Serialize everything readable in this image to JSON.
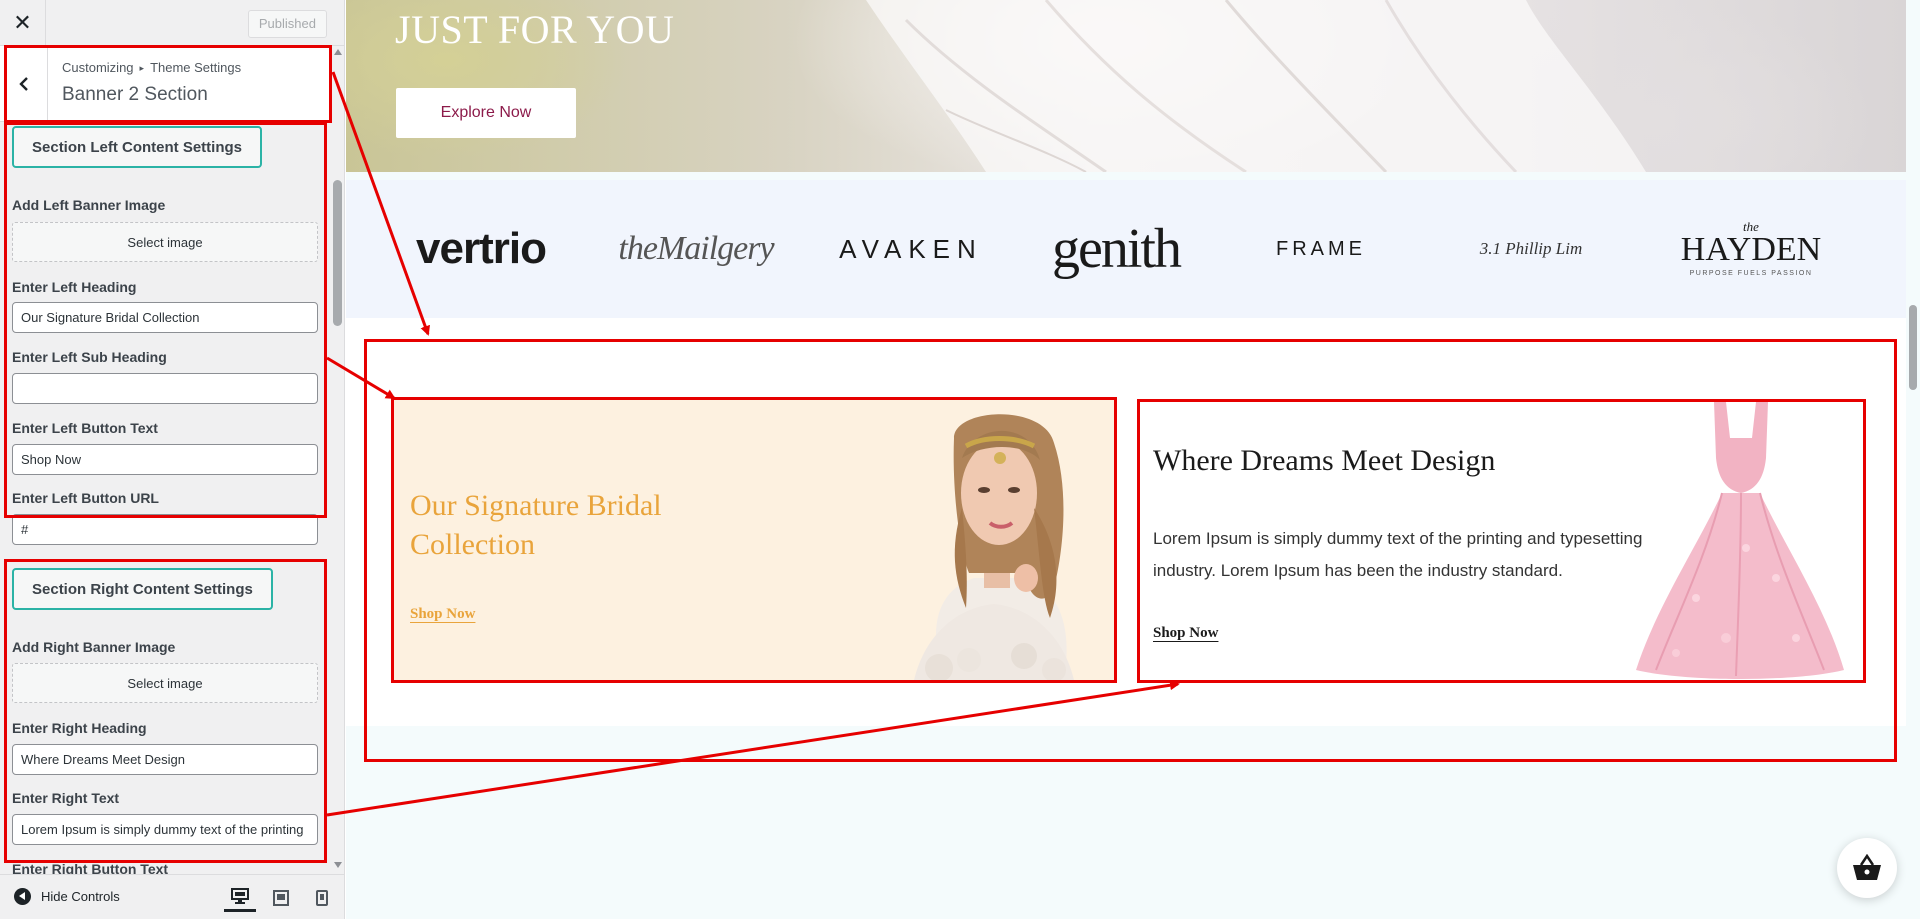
{
  "sidebar": {
    "close_icon": "close-icon",
    "published_label": "Published",
    "breadcrumb": {
      "parent": "Customizing",
      "child": "Theme Settings"
    },
    "section_title": "Banner 2 Section",
    "left_group": {
      "button_label": "Section Left Content Settings",
      "image_label": "Add Left Banner Image",
      "select_image": "Select image",
      "heading_label": "Enter Left Heading",
      "heading_value": "Our Signature Bridal Collection",
      "subheading_label": "Enter Left Sub Heading",
      "subheading_value": "",
      "button_text_label": "Enter Left Button Text",
      "button_text_value": "Shop Now",
      "button_url_label": "Enter Left Button URL",
      "button_url_value": "#"
    },
    "right_group": {
      "button_label": "Section Right Content Settings",
      "image_label": "Add Right Banner Image",
      "select_image": "Select image",
      "heading_label": "Enter Right Heading",
      "heading_value": "Where Dreams Meet Design",
      "text_label": "Enter Right Text",
      "text_value": "Lorem Ipsum is simply dummy text of the printing",
      "button_text_label": "Enter Right Button Text"
    },
    "footer": {
      "hide_controls": "Hide Controls",
      "devices": [
        "desktop-icon",
        "tablet-icon",
        "mobile-icon"
      ],
      "active_device": "desktop"
    }
  },
  "preview": {
    "hero": {
      "title": "JUST FOR YOU",
      "button": "Explore Now"
    },
    "brands": [
      "vertrio",
      "theMailgery",
      "AVAKEN",
      "genith",
      "FRAME",
      "3.1 Phillip Lim",
      "HAYDEN"
    ],
    "brand_extras": {
      "hayden_the": "the",
      "hayden_tagline": "PURPOSE FUELS PASSION"
    },
    "left_banner": {
      "heading": "Our Signature Bridal Collection",
      "button": "Shop Now"
    },
    "right_banner": {
      "heading": "Where Dreams Meet Design",
      "text": "Lorem Ipsum is simply dummy text of the printing and typesetting industry. Lorem Ipsum has been the industry standard.",
      "button": "Shop Now"
    },
    "cart_icon": "shopping-basket-icon"
  },
  "colors": {
    "annotation": "#e60000",
    "accent_teal": "#2bb3a6",
    "left_heading": "#e9a43b",
    "left_bg": "#fdf1e0",
    "explore_text": "#8c1b4a"
  }
}
